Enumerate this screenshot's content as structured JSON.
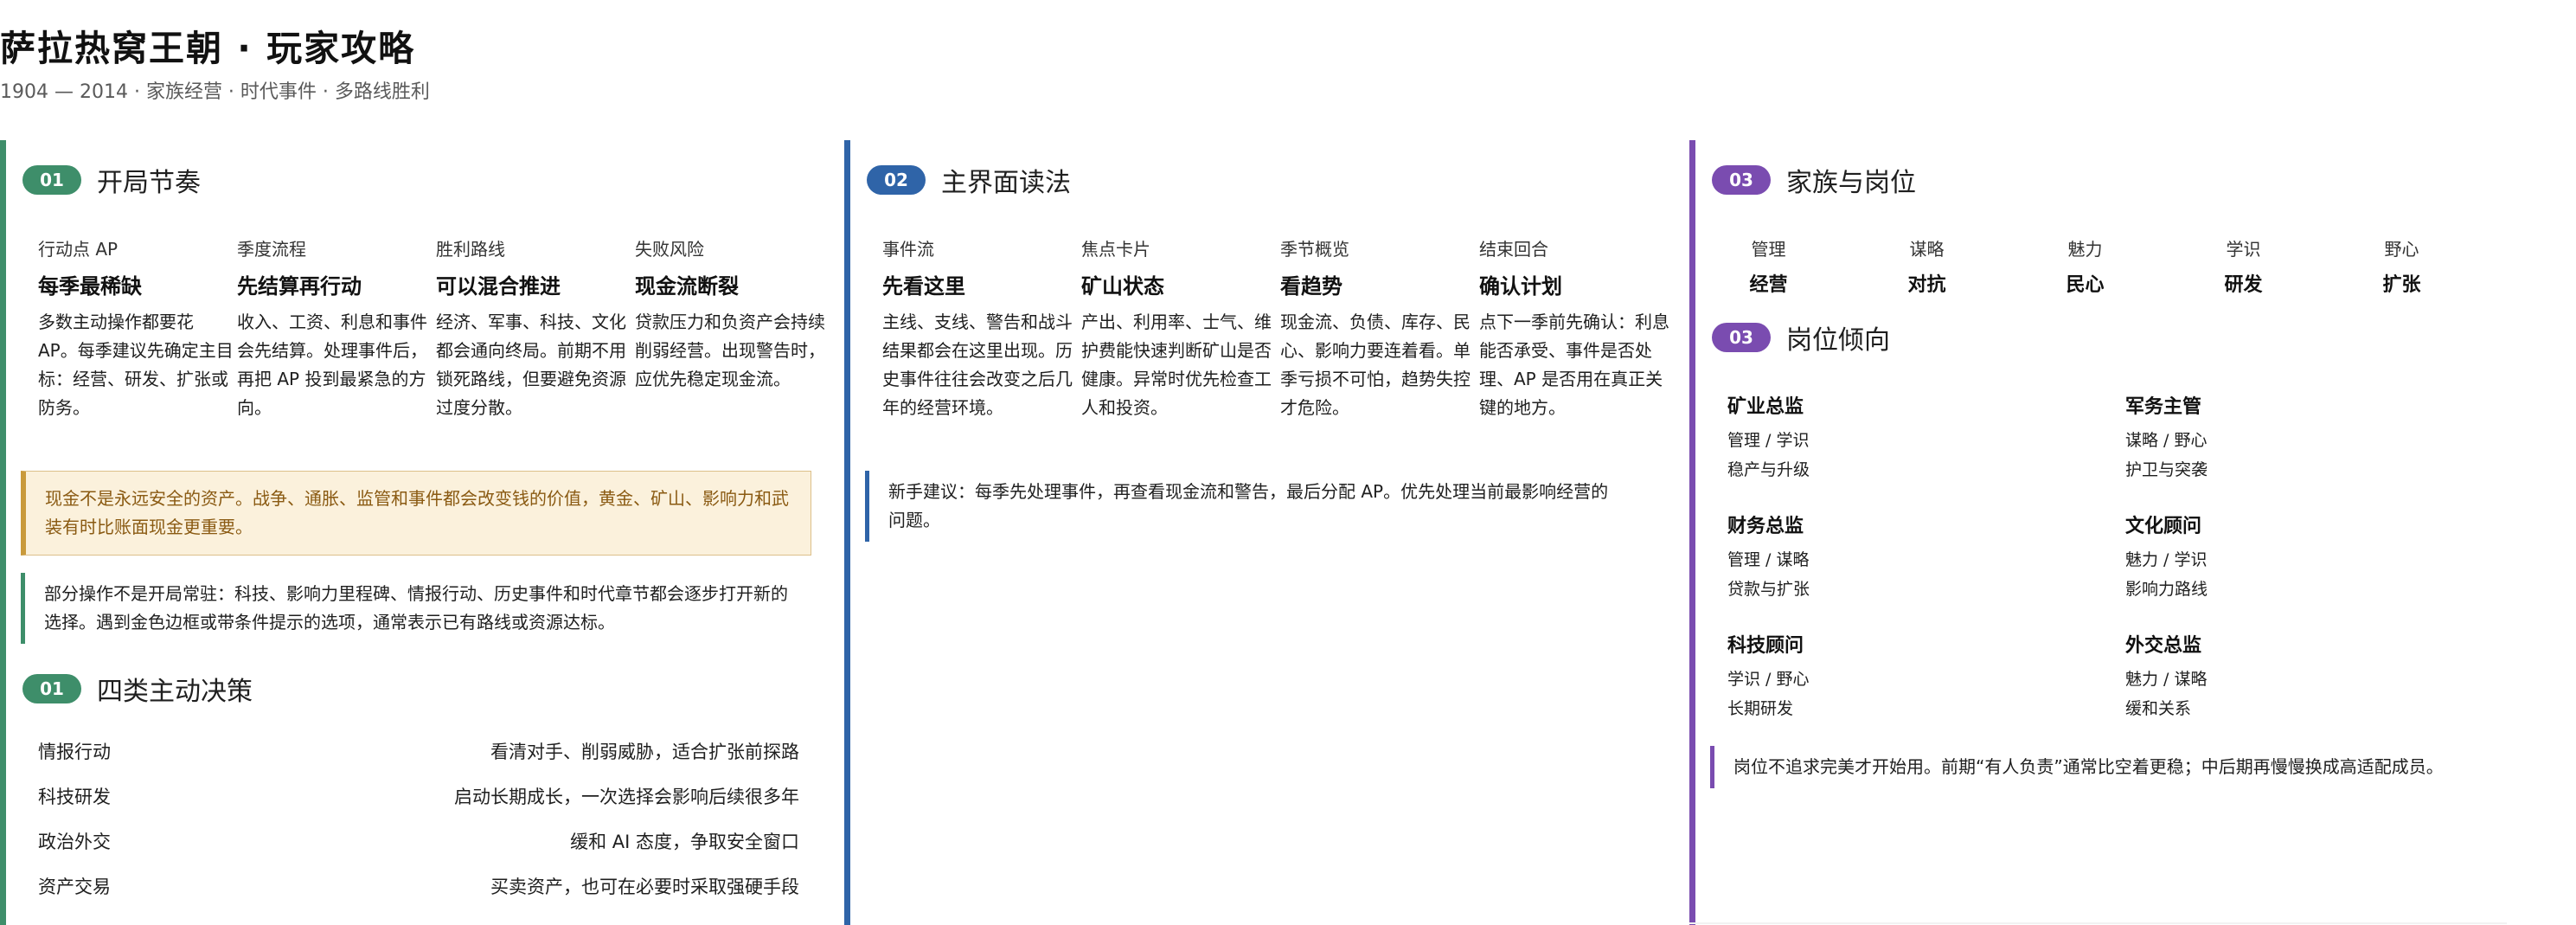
{
  "header": {
    "title": "萨拉热窝王朝 · 玩家攻略",
    "subtitle": "1904 — 2014 · 家族经营 · 时代事件 · 多路线胜利"
  },
  "col1": {
    "section1": {
      "number": "01",
      "title": "开局节奏",
      "cards": [
        {
          "kicker": "行动点 AP",
          "headline": "每季最稀缺",
          "body": "多数主动操作都要花 AP。每季建议先确定主目标：经营、研发、扩张或防务。"
        },
        {
          "kicker": "季度流程",
          "headline": "先结算再行动",
          "body": "收入、工资、利息和事件会先结算。处理事件后，再把 AP 投到最紧急的方向。"
        },
        {
          "kicker": "胜利路线",
          "headline": "可以混合推进",
          "body": "经济、军事、科技、文化都会通向终局。前期不用锁死路线，但要避免资源过度分散。"
        },
        {
          "kicker": "失败风险",
          "headline": "现金流断裂",
          "body": "贷款压力和负资产会持续削弱经营。出现警告时，应优先稳定现金流。"
        }
      ],
      "warning": "现金不是永远安全的资产。战争、通胀、监管和事件都会改变钱的价值，黄金、矿山、影响力和武装有时比账面现金更重要。",
      "note": "部分操作不是开局常驻：科技、影响力里程碑、情报行动、历史事件和时代章节都会逐步打开新的选择。遇到金色边框或带条件提示的选项，通常表示已有路线或资源达标。"
    },
    "section2": {
      "number": "01",
      "title": "四类主动决策",
      "rows": [
        {
          "label": "情报行动",
          "desc": "看清对手、削弱威胁，适合扩张前探路"
        },
        {
          "label": "科技研发",
          "desc": "启动长期成长，一次选择会影响后续很多年"
        },
        {
          "label": "政治外交",
          "desc": "缓和 AI 态度，争取安全窗口"
        },
        {
          "label": "资产交易",
          "desc": "买卖资产，也可在必要时采取强硬手段"
        }
      ]
    }
  },
  "col2": {
    "section": {
      "number": "02",
      "title": "主界面读法",
      "cards": [
        {
          "kicker": "事件流",
          "headline": "先看这里",
          "body": "主线、支线、警告和战斗结果都会在这里出现。历史事件往往会改变之后几年的经营环境。"
        },
        {
          "kicker": "焦点卡片",
          "headline": "矿山状态",
          "body": "产出、利用率、士气、维护费能快速判断矿山是否健康。异常时优先检查工人和投资。"
        },
        {
          "kicker": "季节概览",
          "headline": "看趋势",
          "body": "现金流、负债、库存、民心、影响力要连着看。单季亏损不可怕，趋势失控才危险。"
        },
        {
          "kicker": "结束回合",
          "headline": "确认计划",
          "body": "点下一季前先确认：利息能否承受、事件是否处理、AP 是否用在真正关键的地方。"
        }
      ],
      "note": "新手建议：每季先处理事件，再查看现金流和警告，最后分配 AP。优先处理当前最影响经营的问题。"
    }
  },
  "col3": {
    "section1": {
      "number": "03",
      "title": "家族与岗位",
      "attrs": [
        {
          "name": "管理",
          "use": "经营"
        },
        {
          "name": "谋略",
          "use": "对抗"
        },
        {
          "name": "魅力",
          "use": "民心"
        },
        {
          "name": "学识",
          "use": "研发"
        },
        {
          "name": "野心",
          "use": "扩张"
        }
      ]
    },
    "section2": {
      "number": "03",
      "title": "岗位倾向",
      "roles": [
        {
          "name": "矿业总监",
          "stats": "管理 / 学识",
          "focus": "稳产与升级"
        },
        {
          "name": "军务主管",
          "stats": "谋略 / 野心",
          "focus": "护卫与突袭"
        },
        {
          "name": "财务总监",
          "stats": "管理 / 谋略",
          "focus": "贷款与扩张"
        },
        {
          "name": "文化顾问",
          "stats": "魅力 / 学识",
          "focus": "影响力路线"
        },
        {
          "name": "科技顾问",
          "stats": "学识 / 野心",
          "focus": "长期研发"
        },
        {
          "name": "外交总监",
          "stats": "魅力 / 谋略",
          "focus": "缓和关系"
        }
      ],
      "note": "岗位不追求完美才开始用。前期“有人负责”通常比空着更稳；中后期再慢慢换成高适配成员。"
    }
  }
}
